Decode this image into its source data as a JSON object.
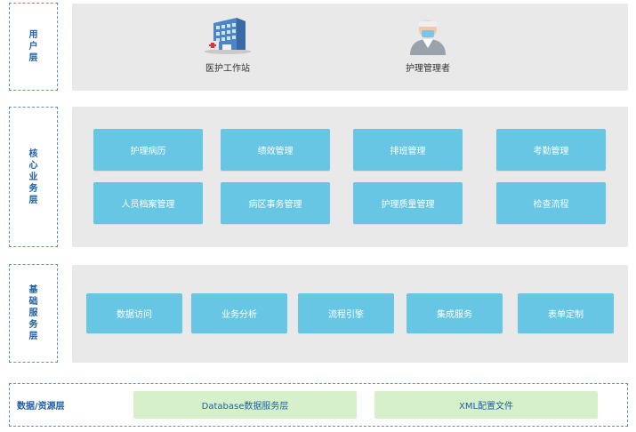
{
  "layers": {
    "user": {
      "label": "用户层",
      "items": [
        {
          "label": "医护工作站",
          "icon": "hospital-building-icon"
        },
        {
          "label": "护理管理者",
          "icon": "nurse-manager-icon"
        }
      ]
    },
    "core": {
      "label": "核心业务层",
      "row1": [
        "护理病历",
        "绩效管理",
        "排班管理",
        "考勤管理"
      ],
      "row2": [
        "人员档案管理",
        "病区事务管理",
        "护理质量管理",
        "检查流程"
      ]
    },
    "base": {
      "label": "基础服务层",
      "items": [
        "数据访问",
        "业务分析",
        "流程引擎",
        "集成服务",
        "表单定制"
      ]
    },
    "data": {
      "label": "数据/资源层",
      "items": [
        "Database数据服务层",
        "XML配置文件"
      ]
    }
  },
  "colors": {
    "box_fill": "#66c6e3",
    "panel_fill": "#e9e9e9",
    "label_text": "#1f5fa6",
    "data_box_fill": "#d5f0cb",
    "dashed_border": "#5b8fc9"
  }
}
